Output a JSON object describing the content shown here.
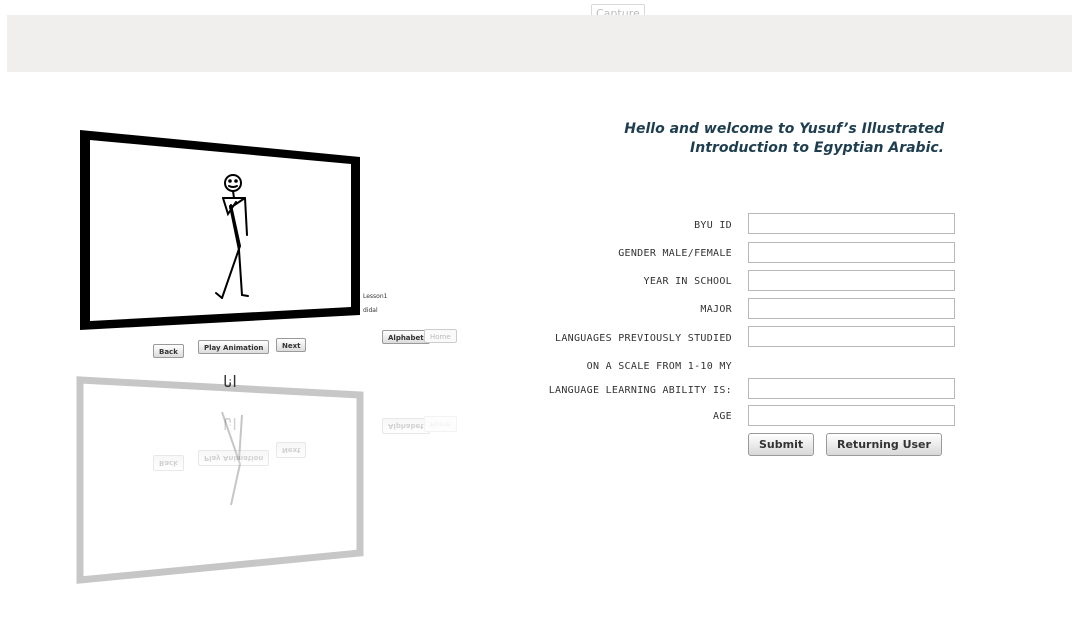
{
  "capture_label": "Capture",
  "animation": {
    "lesson_label": "Lesson1",
    "sub_label": "didal",
    "buttons": {
      "back": "Back",
      "play": "Play Animation",
      "next": "Next",
      "alphabet": "Alphabet",
      "home": "Home"
    },
    "arabic_word": "انا"
  },
  "welcome": {
    "line1": "Hello and welcome to Yusuf’s Illustrated",
    "line2": "Introduction to Egyptian Arabic."
  },
  "form": {
    "byu_id_label": "BYU ID",
    "gender_label": "GENDER MALE/FEMALE",
    "year_label": "YEAR IN SCHOOL",
    "major_label": "MAJOR",
    "languages_label": "LANGUAGES PREVIOUSLY STUDIED",
    "scale_label_line1": "ON A SCALE FROM 1-10 MY",
    "scale_label_line2": "LANGUAGE LEARNING ABILITY IS:",
    "age_label": "AGE",
    "submit_label": "Submit",
    "returning_label": "Returning User"
  }
}
